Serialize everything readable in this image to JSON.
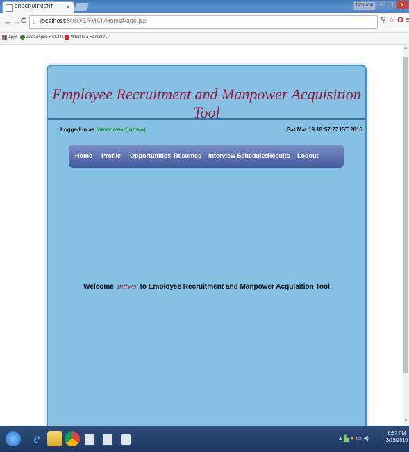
{
  "browser": {
    "tab_title": "ERECRUITMENT",
    "tab_close": "x",
    "url_host": "localhost",
    "url_rest": ":8080/ERMAT/HomePage.jsp",
    "back": "←",
    "forward": "→",
    "reload": "C",
    "window_user": "technical",
    "minimize": "–",
    "maximize": "□",
    "close": "x",
    "bookmarks": [
      "Apps",
      "Acer Aspire E51-111",
      "What Is a Servlet? - T"
    ]
  },
  "app": {
    "title": "Employee Recruitment and Manpower Acquisition Tool",
    "logged_in_prefix": "Logged in as ",
    "logged_in_user": "Interviewer(inttwo)",
    "datetime": "Sat Mar 19 18:57:27 IST 2016",
    "nav": [
      "Home",
      "Profile",
      "Opportunities",
      "Resumes",
      "Interview Schedules",
      "Results",
      "Logout"
    ],
    "welcome_prefix": "Welcome ",
    "welcome_user": "'inttwo'",
    "welcome_suffix": " to Employee Recruitment and Manpower Acquisition Tool"
  },
  "taskbar": {
    "time": "6:57 PM",
    "date": "3/19/2016"
  },
  "colors": {
    "panel_bg": "#85c1e3",
    "title_color": "#9c1b3e",
    "user_green": "#1d8e2a",
    "navbar": "#5a6fb0"
  }
}
